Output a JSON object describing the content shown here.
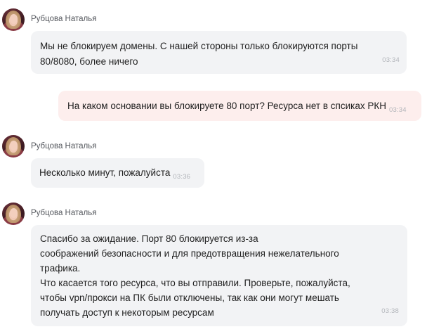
{
  "messages": [
    {
      "sender": "Рубцова Наталья",
      "text": "Мы не блокируем домены. С нашей стороны только блокируются порты\n80/8080, более ничего",
      "time": "03:34"
    },
    {
      "text": "На каком основании вы блокируете 80 порт? Ресурса нет в спсиках РКН",
      "time": "03:34"
    },
    {
      "sender": "Рубцова Наталья",
      "text": "Несколько минут, пожалуйста",
      "time": "03:36"
    },
    {
      "sender": "Рубцова Наталья",
      "text": "Спасибо за ожидание. Порт 80 блокируется из-за\nсоображений безопасности и для предотвращения нежелательного\nтрафика.\nЧто касается того ресурса, что вы отправили. Проверьте, пожалуйста,\nчтобы vpn/прокси на ПК были отключены, так как они могут мешать\nполучать доступ к некоторым ресурсам",
      "time": "03:38"
    }
  ]
}
